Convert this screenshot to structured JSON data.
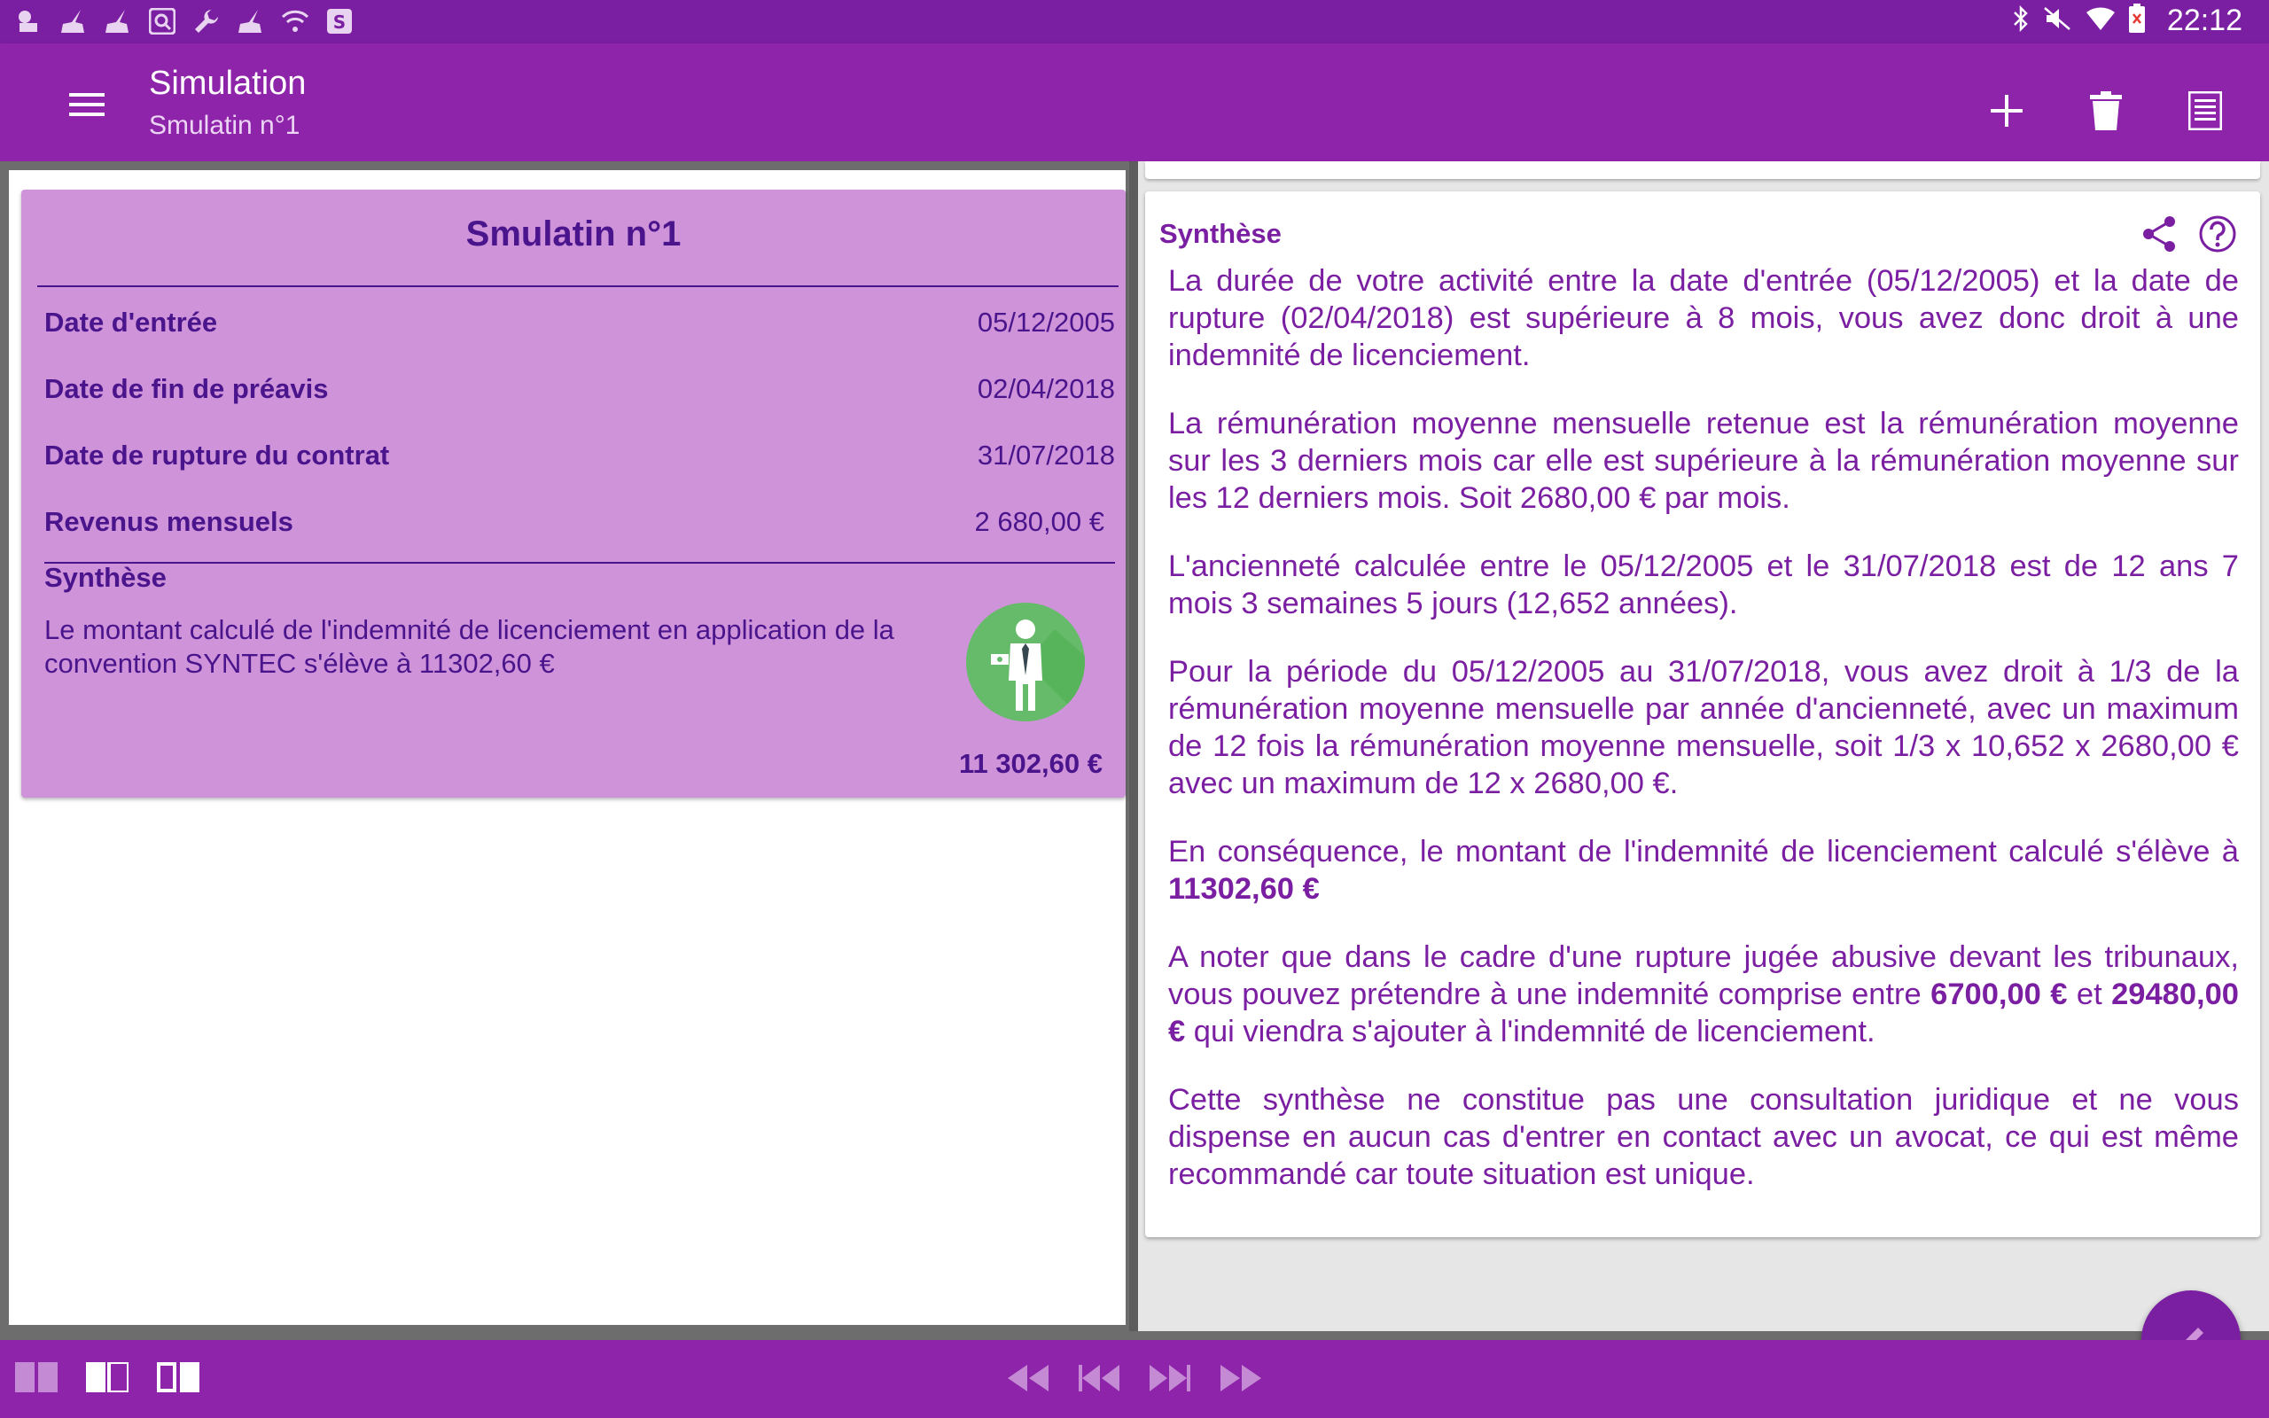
{
  "status_bar": {
    "time": "22:12",
    "left_icons": [
      "notification-icon",
      "broom-icon",
      "broom-icon",
      "search-icon",
      "wrench-icon",
      "broom-icon",
      "wifi-question-icon",
      "s-app-icon"
    ],
    "right_icons": [
      "bluetooth-icon",
      "mute-icon",
      "wifi-icon",
      "battery-icon"
    ]
  },
  "app_bar": {
    "title": "Simulation",
    "subtitle": "Smulatin n°1",
    "actions": [
      "add-icon",
      "delete-icon",
      "list-icon"
    ]
  },
  "simulation_card": {
    "title": "Smulatin n°1",
    "fields": [
      {
        "label": "Date d'entrée",
        "value": "05/12/2005"
      },
      {
        "label": "Date de fin de préavis",
        "value": "02/04/2018"
      },
      {
        "label": "Date de rupture du contrat",
        "value": "31/07/2018"
      },
      {
        "label": "Revenus mensuels",
        "value": "2 680,00 €"
      }
    ],
    "synthese_heading": "Synthèse",
    "synthese_text": "Le montant calculé de l'indemnité de licenciement en application de la convention SYNTEC s'élève à 11302,60 €",
    "total": "11 302,60 €"
  },
  "synthese_card": {
    "heading": "Synthèse",
    "paragraphs": [
      {
        "text": "La durée de votre activité entre la date d'entrée (05/12/2005) et la date de rupture (02/04/2018) est supérieure à 8 mois, vous avez donc droit à une indemnité de licenciement."
      },
      {
        "text": "La rémunération moyenne mensuelle retenue est la rémunération moyenne sur les 3 derniers mois car elle est supérieure à la rémunération moyenne sur les 12 derniers mois. Soit 2680,00 € par mois."
      },
      {
        "text": "L'ancienneté calculée entre le 05/12/2005 et le 31/07/2018 est de 12 ans 7 mois 3 semaines 5 jours (12,652 années)."
      },
      {
        "text": "Pour la période du 05/12/2005 au 31/07/2018, vous avez droit à 1/3 de la rémunération moyenne mensuelle par année d'ancienneté, avec un maximum de 12 fois la rémunération moyenne mensuelle, soit 1/3 x 10,652 x 2680,00 € avec un maximum de 12 x 2680,00 €."
      },
      {
        "text_before": "En conséquence, le montant de l'indemnité de licenciement calculé s'élève à ",
        "bold": "11302,60 €"
      },
      {
        "text_before": "A noter que dans le cadre d'une rupture jugée abusive devant les tribunaux, vous pouvez prétendre à une indemnité comprise entre ",
        "bold1": "6700,00 €",
        "text_middle": " et ",
        "bold2": "29480,00 €",
        "text_after": " qui viendra s'ajouter à l'indemnité de licenciement."
      },
      {
        "text": "Cette synthèse ne constitue pas une consultation juridique et ne vous dispense en aucun cas d'entrer en contact avec un avocat, ce qui est même recommandé car toute situation est unique."
      }
    ]
  },
  "bottom_bar": {
    "layout_buttons": [
      "single-pane-icon",
      "split-pane-icon",
      "split-pane-right-icon"
    ],
    "nav_buttons": [
      "rewind-icon",
      "skip-previous-icon",
      "skip-next-icon",
      "fast-forward-icon"
    ]
  },
  "colors": {
    "primary": "#8e24aa",
    "primary_dark": "#7b1fa2",
    "card_bg": "#ce93d8",
    "text_dark": "#4a148c",
    "avatar_bg": "#66bb6a"
  }
}
